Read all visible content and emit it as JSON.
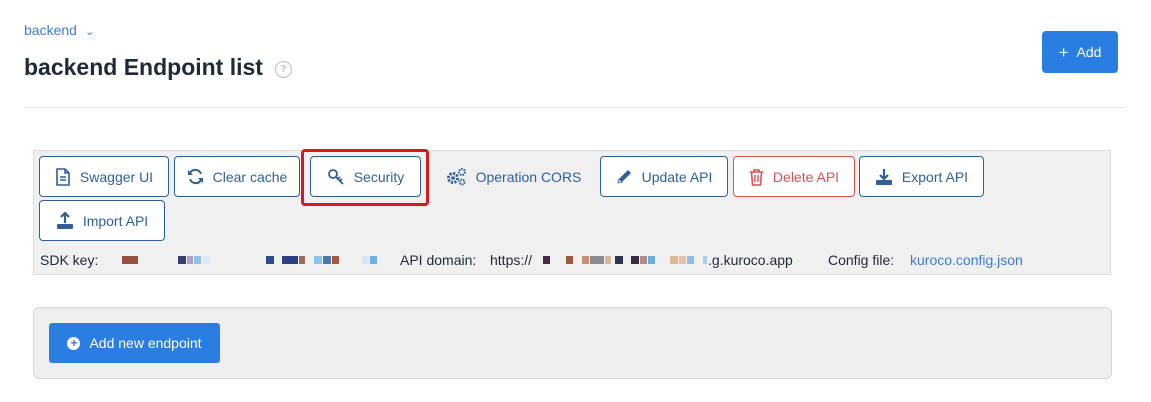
{
  "breadcrumb": {
    "label": "backend"
  },
  "header": {
    "title": "backend Endpoint list",
    "add_label": "Add"
  },
  "toolbar": {
    "buttons": [
      {
        "label": "Swagger UI",
        "icon": "document-icon"
      },
      {
        "label": "Clear cache",
        "icon": "refresh-icon"
      },
      {
        "label": "Security",
        "icon": "key-icon"
      },
      {
        "label": "Operation CORS",
        "icon": "gears-icon"
      },
      {
        "label": "Update API",
        "icon": "pencil-icon"
      },
      {
        "label": "Delete API",
        "icon": "trash-icon"
      },
      {
        "label": "Export API",
        "icon": "download-icon"
      },
      {
        "label": "Import API",
        "icon": "upload-icon"
      }
    ]
  },
  "info": {
    "sdk_key_label": "SDK key:",
    "api_domain_label": "API domain:",
    "api_domain_prefix": "https://",
    "api_domain_suffix": ".g.kuroco.app",
    "config_file_label": "Config file:",
    "config_file_value": "kuroco.config.json"
  },
  "endpoints": {
    "add_label": "Add new endpoint"
  },
  "colors": {
    "primary": "#2a7de1",
    "outline": "#2f5f99",
    "danger": "#d9534f",
    "highlight": "#d41b1b",
    "link": "#3b7dd8"
  }
}
